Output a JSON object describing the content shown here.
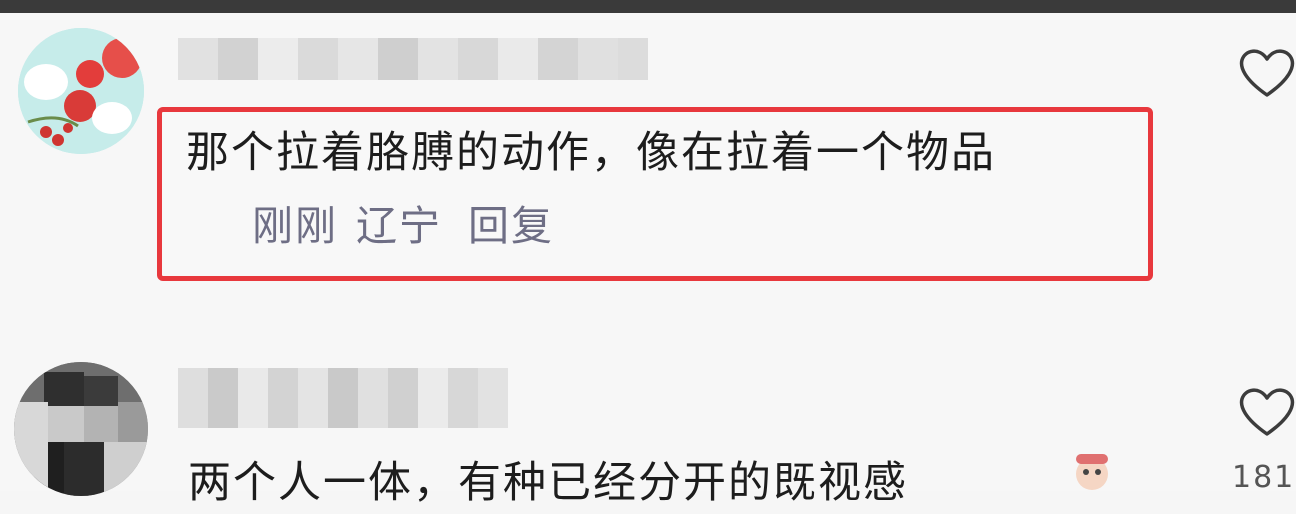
{
  "comments": [
    {
      "text": "那个拉着胳膊的动作，像在拉着一个物品",
      "time": "刚刚",
      "location": "辽宁",
      "reply_label": "回复",
      "like_icon": "heart-outline-icon"
    },
    {
      "text": "两个人一体，有种已经分开的既视感",
      "like_icon": "heart-outline-icon",
      "like_count": "181"
    }
  ],
  "colors": {
    "highlight": "#e8383d",
    "meta_text": "#6e6e85",
    "body_text": "#1d1d1d"
  }
}
